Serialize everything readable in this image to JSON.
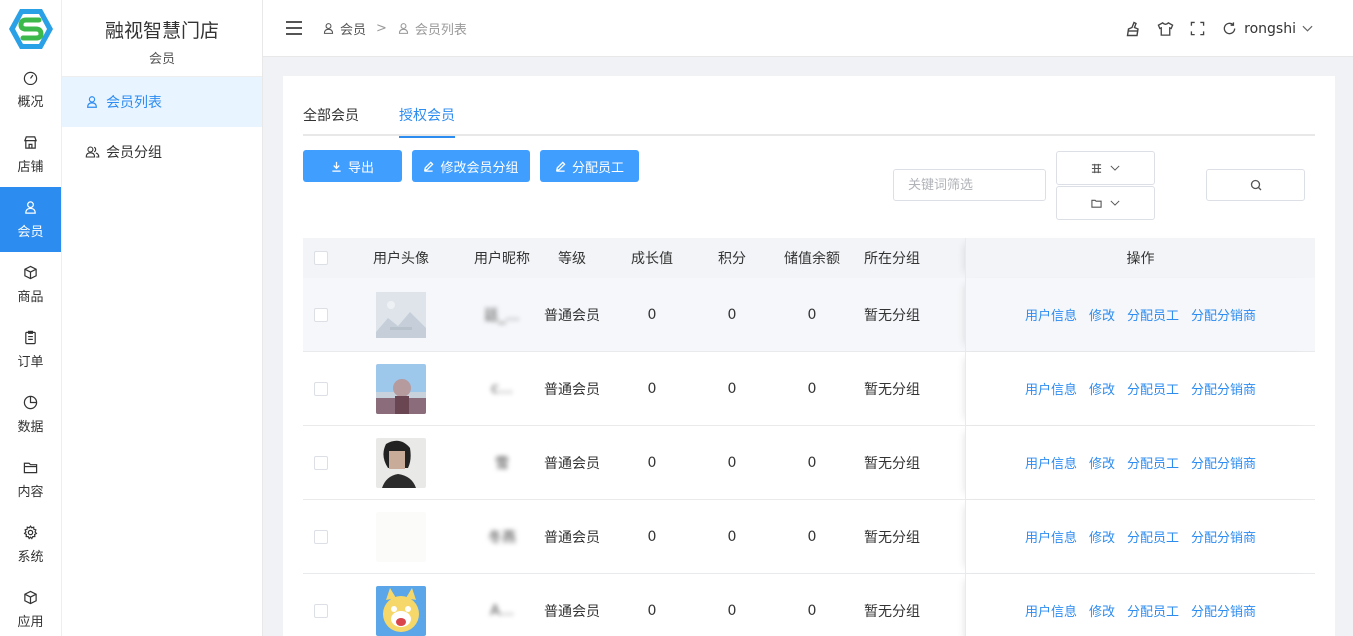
{
  "rail": {
    "items": [
      {
        "label": "概况",
        "icon": "dashboard-icon"
      },
      {
        "label": "店铺",
        "icon": "store-icon"
      },
      {
        "label": "会员",
        "icon": "user-icon"
      },
      {
        "label": "商品",
        "icon": "box-icon"
      },
      {
        "label": "订单",
        "icon": "clipboard-icon"
      },
      {
        "label": "数据",
        "icon": "pie-chart-icon"
      },
      {
        "label": "内容",
        "icon": "folder-icon"
      },
      {
        "label": "系统",
        "icon": "gear-icon"
      },
      {
        "label": "应用",
        "icon": "cube-icon"
      }
    ],
    "active_index": 2
  },
  "sidebar": {
    "store_name": "融视智慧门店",
    "section_title": "会员",
    "items": [
      {
        "label": "会员列表",
        "icon": "user-icon"
      },
      {
        "label": "会员分组",
        "icon": "users-icon"
      }
    ]
  },
  "header": {
    "breadcrumb": [
      "会员",
      "会员列表"
    ],
    "separator": ">",
    "username": "rongshi"
  },
  "tabs": [
    "全部会员",
    "授权会员"
  ],
  "active_tab": 1,
  "toolbar": {
    "export_label": "导出",
    "edit_group_label": "修改会员分组",
    "assign_staff_label": "分配员工"
  },
  "filters": {
    "keyword_placeholder": "关键词筛选"
  },
  "table": {
    "columns": [
      "用户头像",
      "用户昵称",
      "等级",
      "成长值",
      "积分",
      "储值余额",
      "所在分组",
      "操作"
    ],
    "operations": [
      "用户信息",
      "修改",
      "分配员工",
      "分配分销商"
    ],
    "rows": [
      {
        "nickname": "廷_…",
        "level": "普通会员",
        "growth": "0",
        "points": "0",
        "balance": "0",
        "group": "暂无分组"
      },
      {
        "nickname": "c…",
        "level": "普通会员",
        "growth": "0",
        "points": "0",
        "balance": "0",
        "group": "暂无分组"
      },
      {
        "nickname": "雪",
        "level": "普通会员",
        "growth": "0",
        "points": "0",
        "balance": "0",
        "group": "暂无分组"
      },
      {
        "nickname": "冬燕",
        "level": "普通会员",
        "growth": "0",
        "points": "0",
        "balance": "0",
        "group": "暂无分组"
      },
      {
        "nickname": "A…",
        "level": "普通会员",
        "growth": "0",
        "points": "0",
        "balance": "0",
        "group": "暂无分组"
      }
    ]
  },
  "colors": {
    "primary": "#409eff",
    "link": "#2d8cf0",
    "active_rail": "#2d8cf0"
  }
}
